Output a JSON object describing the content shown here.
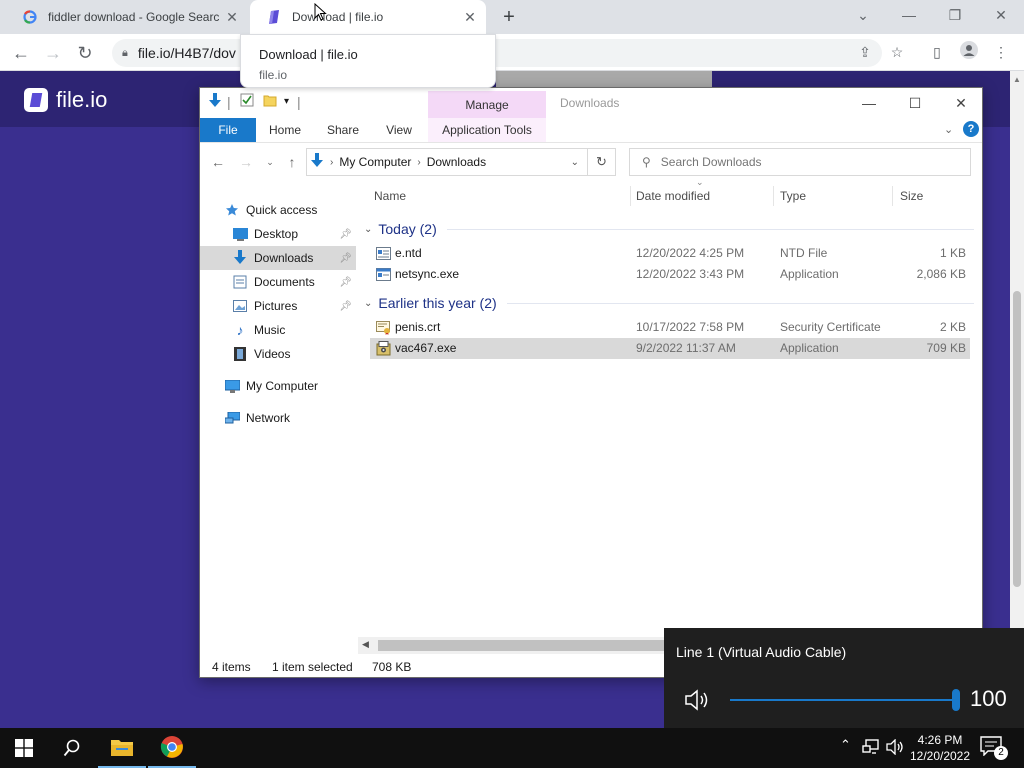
{
  "browser": {
    "tabs": [
      {
        "title": "fiddler download - Google Searc",
        "active": false
      },
      {
        "title": "Download | file.io",
        "active": true
      }
    ],
    "url": "file.io/H4B7/dov",
    "tooltip": {
      "title": "Download | file.io",
      "domain": "file.io"
    }
  },
  "page": {
    "logo_text": "file.io",
    "bg_color": "#3a2f8f",
    "header_color": "#2d2473"
  },
  "explorer": {
    "manage_label": "Manage",
    "window_title": "Downloads",
    "ribbon_tabs": [
      "File",
      "Home",
      "Share",
      "View",
      "Application Tools"
    ],
    "address": [
      "My Computer",
      "Downloads"
    ],
    "search_placeholder": "Search Downloads",
    "nav": [
      {
        "label": "Quick access",
        "icon": "star-icon"
      },
      {
        "label": "Desktop",
        "icon": "desktop-icon",
        "pinned": true
      },
      {
        "label": "Downloads",
        "icon": "download-arrow-icon",
        "pinned": true,
        "selected": true
      },
      {
        "label": "Documents",
        "icon": "document-icon",
        "pinned": true
      },
      {
        "label": "Pictures",
        "icon": "picture-icon",
        "pinned": true
      },
      {
        "label": "Music",
        "icon": "music-icon"
      },
      {
        "label": "Videos",
        "icon": "video-icon"
      },
      {
        "label": "My Computer",
        "icon": "computer-icon"
      },
      {
        "label": "Network",
        "icon": "network-icon"
      }
    ],
    "columns": [
      "Name",
      "Date modified",
      "Type",
      "Size"
    ],
    "groups": [
      {
        "label": "Today (2)",
        "files": [
          {
            "name": "e.ntd",
            "date": "12/20/2022 4:25 PM",
            "type": "NTD File",
            "size": "1 KB",
            "icon": "generic-file-icon"
          },
          {
            "name": "netsync.exe",
            "date": "12/20/2022 3:43 PM",
            "type": "Application",
            "size": "2,086 KB",
            "icon": "application-icon"
          }
        ]
      },
      {
        "label": "Earlier this year (2)",
        "files": [
          {
            "name": "penis.crt",
            "date": "10/17/2022 7:58 PM",
            "type": "Security Certificate",
            "size": "2 KB",
            "icon": "certificate-icon"
          },
          {
            "name": "vac467.exe",
            "date": "9/2/2022 11:37 AM",
            "type": "Application",
            "size": "709 KB",
            "icon": "installer-icon",
            "selected": true
          }
        ]
      }
    ],
    "status": {
      "items": "4 items",
      "selected": "1 item selected",
      "size": "708 KB"
    }
  },
  "volume": {
    "device": "Line 1 (Virtual Audio Cable)",
    "level": 100,
    "level_label": "100"
  },
  "taskbar": {
    "time": "4:26 PM",
    "date": "12/20/2022",
    "notifications": "2"
  },
  "colors": {
    "accent": "#1979ca",
    "manage_tab": "#f4d9f7",
    "selection": "#d9d9d9"
  }
}
